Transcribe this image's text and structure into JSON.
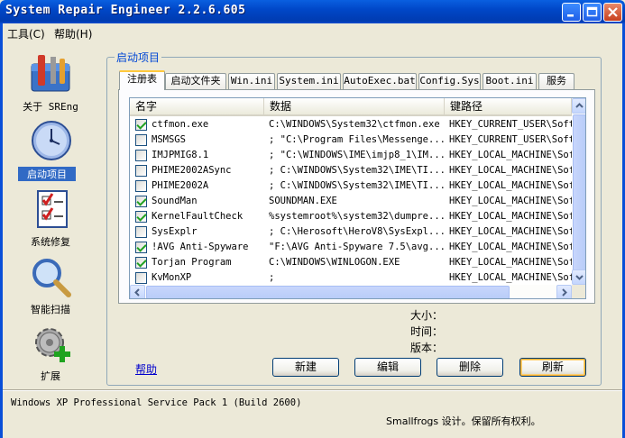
{
  "window": {
    "title": "System Repair Engineer 2.2.6.605"
  },
  "menu": [
    {
      "label": "工具(C)"
    },
    {
      "label": "帮助(H)"
    }
  ],
  "nav": [
    {
      "label": "关于 SREng",
      "icon": "toolbox-icon"
    },
    {
      "label": "启动项目",
      "icon": "clock-icon",
      "selected": true
    },
    {
      "label": "系统修复",
      "icon": "checklist-icon"
    },
    {
      "label": "智能扫描",
      "icon": "magnifier-icon"
    },
    {
      "label": "扩展",
      "icon": "gear-plus-icon"
    }
  ],
  "group_title": "启动项目",
  "tabs": [
    {
      "label": "注册表",
      "active": true
    },
    {
      "label": "启动文件夹"
    },
    {
      "label": "Win.ini"
    },
    {
      "label": "System.ini"
    },
    {
      "label": "AutoExec.bat"
    },
    {
      "label": "Config.Sys"
    },
    {
      "label": "Boot.ini"
    },
    {
      "label": "服务"
    }
  ],
  "list": {
    "columns": [
      "名字",
      "数据",
      "键路径"
    ],
    "rows": [
      {
        "checked": true,
        "name": "ctfmon.exe",
        "data": "C:\\WINDOWS\\System32\\ctfmon.exe",
        "path": "HKEY_CURRENT_USER\\Soft"
      },
      {
        "checked": false,
        "name": "MSMSGS",
        "data": "; \"C:\\Program Files\\Messenge...",
        "path": "HKEY_CURRENT_USER\\Soft"
      },
      {
        "checked": false,
        "name": "IMJPMIG8.1",
        "data": "; \"C:\\WINDOWS\\IME\\imjp8_1\\IM...",
        "path": "HKEY_LOCAL_MACHINE\\Sof"
      },
      {
        "checked": false,
        "name": "PHIME2002ASync",
        "data": "; C:\\WINDOWS\\System32\\IME\\TI...",
        "path": "HKEY_LOCAL_MACHINE\\Sof"
      },
      {
        "checked": false,
        "name": "PHIME2002A",
        "data": "; C:\\WINDOWS\\System32\\IME\\TI...",
        "path": "HKEY_LOCAL_MACHINE\\Sof"
      },
      {
        "checked": true,
        "name": "SoundMan",
        "data": "SOUNDMAN.EXE",
        "path": "HKEY_LOCAL_MACHINE\\Sof"
      },
      {
        "checked": true,
        "name": "KernelFaultCheck",
        "data": "%systemroot%\\system32\\dumpre...",
        "path": "HKEY_LOCAL_MACHINE\\Sof"
      },
      {
        "checked": false,
        "name": "SysExplr",
        "data": "; C:\\Herosoft\\HeroV8\\SysExpl...",
        "path": "HKEY_LOCAL_MACHINE\\Sof"
      },
      {
        "checked": true,
        "name": "!AVG Anti-Spyware",
        "data": "\"F:\\AVG Anti-Spyware 7.5\\avg...",
        "path": "HKEY_LOCAL_MACHINE\\Sof"
      },
      {
        "checked": true,
        "name": "Torjan Program",
        "data": "C:\\WINDOWS\\WINLOGON.EXE",
        "path": "HKEY_LOCAL_MACHINE\\Sof"
      },
      {
        "checked": false,
        "name": "KvMonXP",
        "data": ";",
        "path": "HKEY_LOCAL_MACHINE\\Sof"
      }
    ]
  },
  "info": {
    "size_label": "大小：",
    "time_label": "时间：",
    "version_label": "版本："
  },
  "help_link": "帮助",
  "buttons": {
    "new": "新建",
    "edit": "编辑",
    "delete": "删除",
    "refresh": "刷新"
  },
  "status": {
    "os": "Windows XP Professional Service Pack 1 (Build 2600)",
    "copyright": "Smallfrogs 设计。保留所有权利。"
  },
  "colors": {
    "titlebar": "#0047C8",
    "selection": "#316AC5",
    "group_title": "#0046D5",
    "link": "#0000CC"
  }
}
